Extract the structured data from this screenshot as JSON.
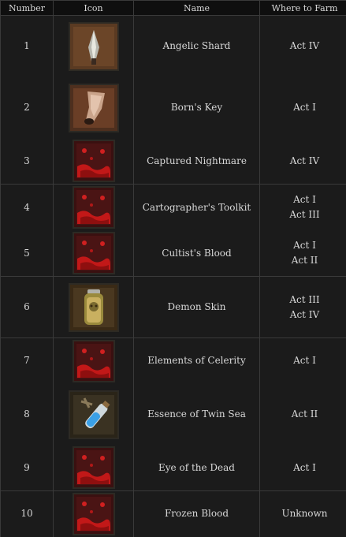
{
  "headers": {
    "number": "Number",
    "icon": "Icon",
    "name": "Name",
    "farm": "Where to Farm"
  },
  "rows": [
    {
      "number": "1",
      "name": "Angelic Shard",
      "farm": [
        "Act IV"
      ],
      "icon": "angelic-shard-icon",
      "size": "big",
      "h": 78,
      "group": true
    },
    {
      "number": "2",
      "name": "Born's Key",
      "farm": [
        "Act I"
      ],
      "icon": "borns-key-icon",
      "size": "big",
      "h": 78,
      "group": false
    },
    {
      "number": "3",
      "name": "Captured Nightmare",
      "farm": [
        "Act IV"
      ],
      "icon": "blood-splatter-icon",
      "size": "small",
      "h": 58,
      "group": false
    },
    {
      "number": "4",
      "name": "Cartographer's Toolkit",
      "farm": [
        "Act I",
        "Act III"
      ],
      "icon": "blood-splatter-icon",
      "size": "small",
      "h": 59,
      "group": true
    },
    {
      "number": "5",
      "name": "Cultist's Blood",
      "farm": [
        "Act I",
        "Act II"
      ],
      "icon": "blood-splatter-icon",
      "size": "small",
      "h": 58,
      "group": false
    },
    {
      "number": "6",
      "name": "Demon Skin",
      "farm": [
        "Act III",
        "Act IV"
      ],
      "icon": "demon-skin-jar-icon",
      "size": "big",
      "h": 78,
      "group": true
    },
    {
      "number": "7",
      "name": "Elements of Celerity",
      "farm": [
        "Act I"
      ],
      "icon": "blood-splatter-icon",
      "size": "small",
      "h": 58,
      "group": true
    },
    {
      "number": "8",
      "name": "Essence of Twin Sea",
      "farm": [
        "Act II"
      ],
      "icon": "essence-vial-icon",
      "size": "big",
      "h": 78,
      "group": false
    },
    {
      "number": "9",
      "name": "Eye of the Dead",
      "farm": [
        "Act I"
      ],
      "icon": "blood-splatter-icon",
      "size": "small",
      "h": 58,
      "group": false
    },
    {
      "number": "10",
      "name": "Frozen Blood",
      "farm": [
        "Unknown"
      ],
      "icon": "blood-splatter-icon",
      "size": "small",
      "h": 58,
      "group": true
    }
  ]
}
